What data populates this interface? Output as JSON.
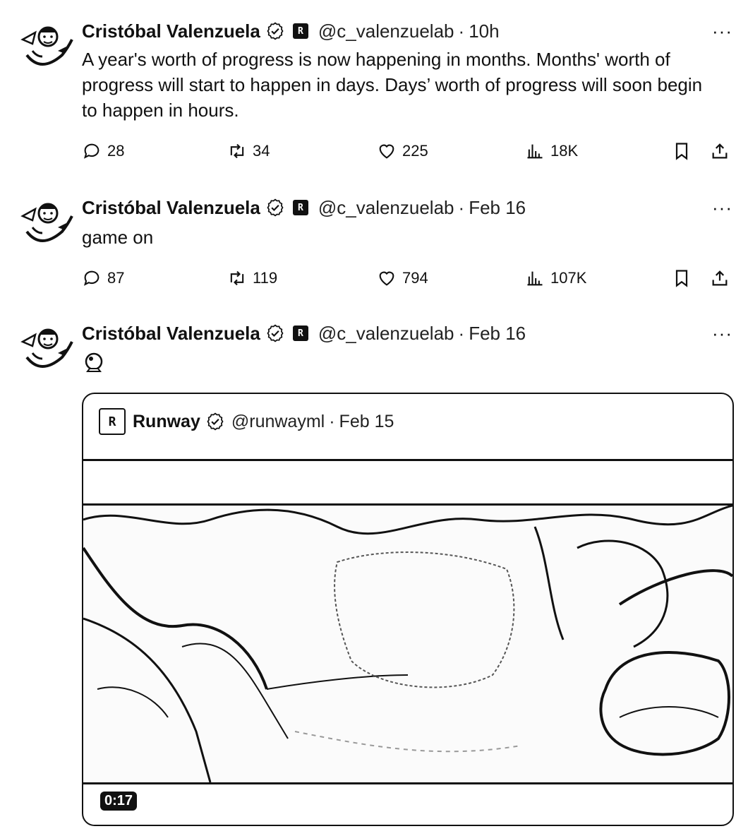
{
  "author": {
    "name": "Cristóbal Valenzuela",
    "handle": "@c_valenzuelab",
    "badge_text": "R"
  },
  "more_label": "···",
  "separator": "·",
  "tweets": [
    {
      "time": "10h",
      "text": "A year's worth of progress is now happening in months. Months' worth of progress will start to happen in days. Days’ worth of progress will soon begin to happen in hours.",
      "replies": "28",
      "reposts": "34",
      "likes": "225",
      "views": "18K"
    },
    {
      "time": "Feb 16",
      "text": "game on",
      "replies": "87",
      "reposts": "119",
      "likes": "794",
      "views": "107K"
    },
    {
      "time": "Feb 16",
      "emoji_icon": "crystal-ball-icon"
    }
  ],
  "quoted": {
    "name": "Runway",
    "handle": "@runwayml",
    "time": "Feb 15",
    "logo_text": "R",
    "video_duration": "0:17"
  }
}
